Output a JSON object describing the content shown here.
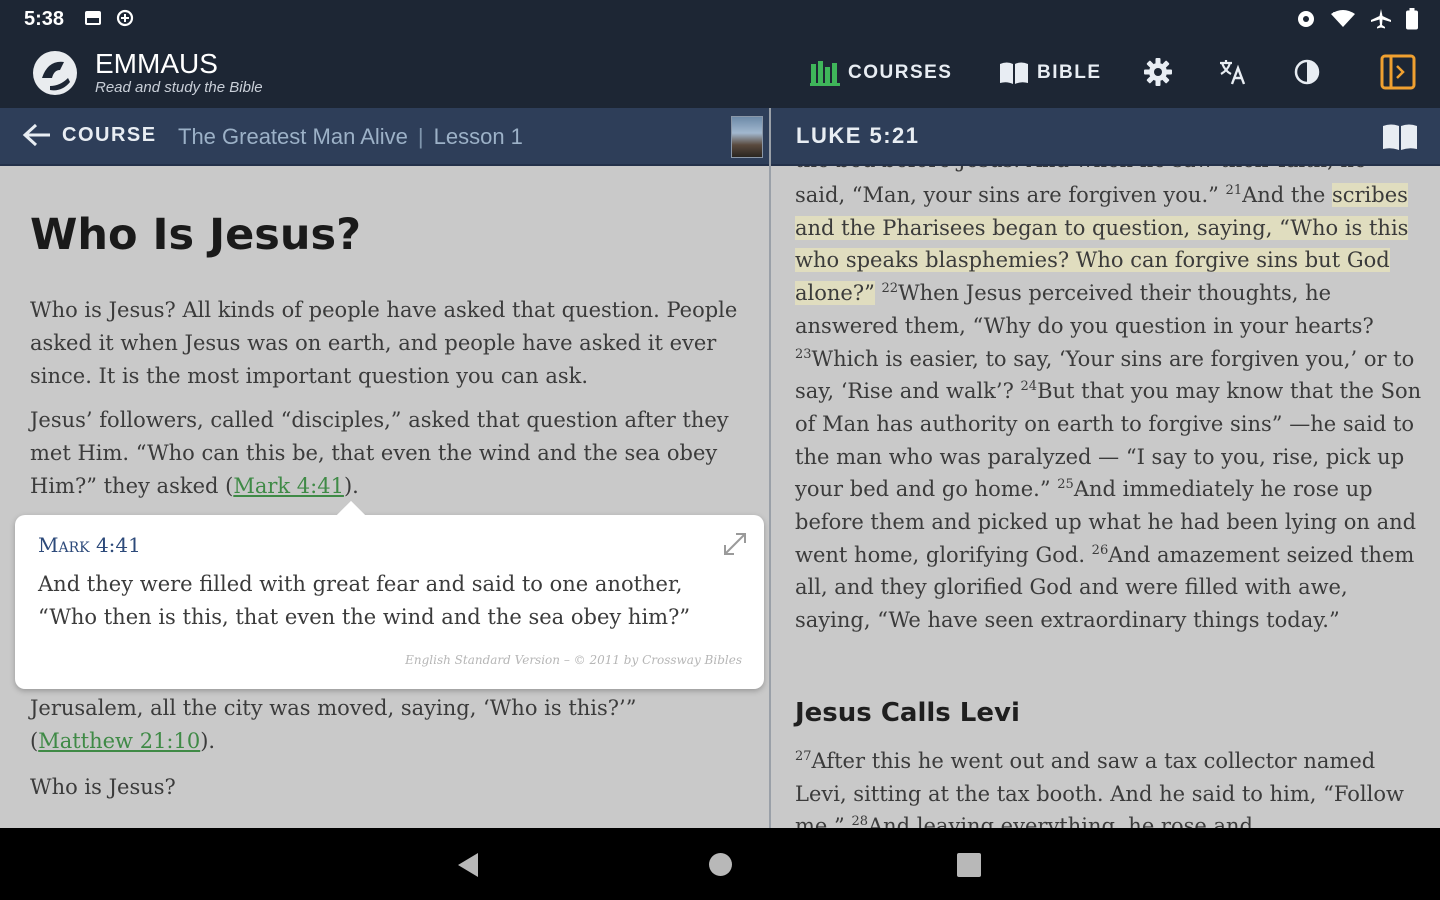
{
  "status_bar": {
    "time": "5:38"
  },
  "app": {
    "brand_name": "EMMAUS",
    "brand_tagline": "Read and study the Bible",
    "nav": {
      "courses_label": "COURSES",
      "bible_label": "BIBLE"
    },
    "accent_color": "#f0a030",
    "courses_icon_color": "#3fb65a"
  },
  "left_panel": {
    "back_label": "COURSE",
    "course_name": "The Greatest Man Alive",
    "separator": "|",
    "lesson": "Lesson 1",
    "heading": "Who Is Jesus?",
    "paragraphs": {
      "p1": "Who is Jesus? All kinds of people have asked that question. People asked it when Jesus was on earth, and people have asked it ever since. It is the most important question you can ask.",
      "p2_before": "Jesus’ followers, called “disciples,” asked that question after they met Him. “Who can this be, that even the wind and the sea obey Him?” they asked (",
      "p2_link": "Mark 4:41",
      "p2_after": ").",
      "p3_before": "Jerusalem, all the city was moved, saying, ‘Who is this?’” (",
      "p3_link": "Matthew 21:10",
      "p3_after": ").",
      "p4": "Who is Jesus?"
    },
    "popup": {
      "reference": "Mark 4:41",
      "text": "And they were filled with great fear and said to one another, “Who then is this, that even the wind and the sea obey him?”",
      "credit": "English Standard Version – © 2011 by Crossway Bibles"
    }
  },
  "right_panel": {
    "reference": "LUKE 5:21",
    "top_partial": "the bed before Jesus. And when he saw their faith, he",
    "text": {
      "a1": "said, “Man, your sins are forgiven you.” ",
      "v21": "21",
      "a2": "And the ",
      "h1": "scribes and the Pharisees began to question, saying, “Who is this who speaks blasphemies? Who can forgive sins but God alone?”",
      "a3": " ",
      "v22": "22",
      "a4": "When Jesus perceived their thoughts, he answered them, “Why do you question in your hearts? ",
      "v23": "23",
      "a5": "Which is easier, to say, ‘Your sins are forgiven you,’ or to say, ‘Rise and walk’? ",
      "v24": "24",
      "a6": "But that you may know that the Son of Man has authority on earth to forgive sins” —he said to the man who was paralyzed — “I say to you, rise, pick up your bed and go home.” ",
      "v25": "25",
      "a7": "And immediately he rose up before them and picked up what he had been lying on and went home, glorifying God. ",
      "v26": "26",
      "a8": "And amazement seized them all, and they glorified God and were filled with awe, saying, “We have seen extraordinary things today.”"
    },
    "section_heading": "Jesus Calls Levi",
    "section_text": {
      "v27": "27",
      "b1": "After this he went out and saw a tax collector named Levi, sitting at the tax booth. And he said to him, “Follow me.” ",
      "v28": "28",
      "b2": "And leaving everything, he rose and"
    },
    "highlight_color": "#e0ddbf"
  }
}
